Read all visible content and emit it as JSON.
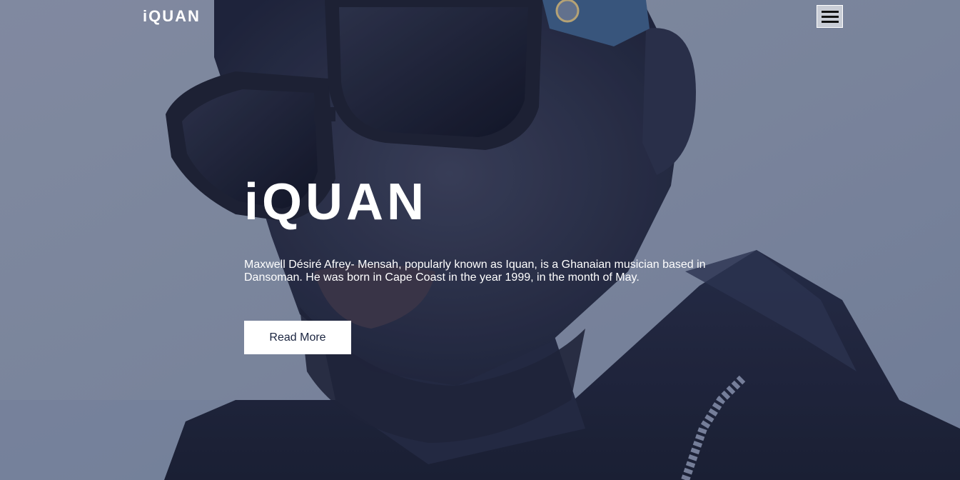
{
  "header": {
    "logo_text": "iQUAN",
    "menu_icon": "hamburger-menu-icon"
  },
  "hero": {
    "title": "iQUAN",
    "description": "Maxwell Désiré Afrey- Mensah, popularly known as Iquan, is a Ghanaian musician based in Dansoman. He was born in Cape Coast in the year 1999, in the month of May.",
    "button_label": "Read More",
    "background_image": "portrait-photo-man-with-sunglasses"
  },
  "colors": {
    "sky": "#8a93a8",
    "text": "#ffffff",
    "button_bg": "#ffffff",
    "button_text": "#1b2540"
  }
}
